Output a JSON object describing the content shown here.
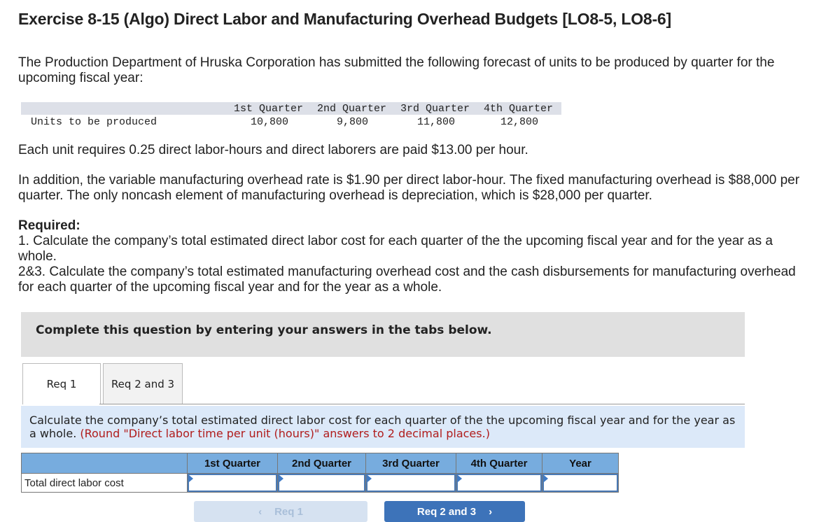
{
  "title": "Exercise 8-15 (Algo) Direct Labor and Manufacturing Overhead Budgets [LO8-5, LO8-6]",
  "intro": "The Production Department of Hruska Corporation has submitted the following forecast of units to be produced by quarter for the upcoming fiscal year:",
  "forecast": {
    "headers": [
      "1st Quarter",
      "2nd Quarter",
      "3rd Quarter",
      "4th Quarter"
    ],
    "row_label": "Units to be produced",
    "values": [
      "10,800",
      "9,800",
      "11,800",
      "12,800"
    ]
  },
  "labor_info": "Each unit requires 0.25 direct labor-hours and direct laborers are paid $13.00 per hour.",
  "overhead_info": "In addition, the variable manufacturing overhead rate is $1.90 per direct labor-hour. The fixed manufacturing overhead is $88,000 per quarter. The only noncash element of manufacturing overhead is depreciation, which is $28,000 per quarter.",
  "required": {
    "heading": "Required:",
    "items": [
      "1. Calculate the company’s total estimated direct labor cost for each quarter of the the upcoming fiscal year and for the year as a whole.",
      "2&3. Calculate the company’s total estimated manufacturing overhead cost and the cash disbursements for manufacturing overhead for each quarter of the upcoming fiscal year and for the year as a whole."
    ]
  },
  "banner": "Complete this question by entering your answers in the tabs below.",
  "tabs": [
    {
      "label": "Req 1",
      "active": true
    },
    {
      "label": "Req 2 and 3",
      "active": false
    }
  ],
  "instruction": {
    "text": "Calculate the company’s total estimated direct labor cost for each quarter of the the upcoming fiscal year and for the year as a whole.",
    "note": "(Round \"Direct labor time per unit (hours)\" answers to 2 decimal places.)"
  },
  "answer_table": {
    "headers": [
      "",
      "1st Quarter",
      "2nd Quarter",
      "3rd Quarter",
      "4th Quarter",
      "Year"
    ],
    "row_label": "Total direct labor cost",
    "values": [
      "",
      "",
      "",
      "",
      ""
    ]
  },
  "nav": {
    "prev_label": "Req 1",
    "next_label": "Req 2 and 3",
    "prev_icon": "‹",
    "next_icon": "›"
  },
  "colors": {
    "table_header": "#77acde",
    "next_button": "#3d73b9",
    "prev_button": "#d6e2f1",
    "instruction_bg": "#dce9f9",
    "note_red": "#b01c1c"
  }
}
